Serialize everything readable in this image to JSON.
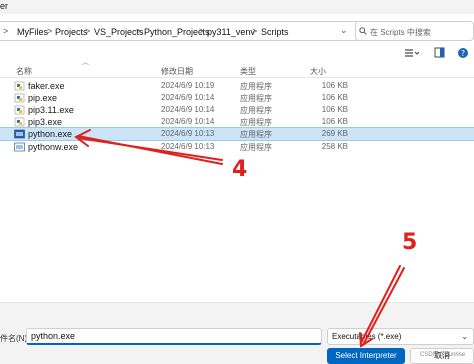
{
  "window": {
    "title_fragment": "er"
  },
  "address_bar": {
    "breadcrumbs": [
      "MyFiles",
      "Projects",
      "VS_Projects",
      "Python_Projects",
      "py311_venv",
      "Scripts"
    ],
    "separator": ">"
  },
  "search": {
    "placeholder": "在 Scripts 中搜索",
    "icon": "search-icon"
  },
  "toolbar": {
    "view_icon": "view-menu-icon",
    "preview_icon": "preview-pane-icon",
    "help_icon": "help-icon"
  },
  "columns": {
    "name": "名称",
    "date": "修改日期",
    "type": "类型",
    "size": "大小"
  },
  "files": [
    {
      "name": "faker.exe",
      "date": "2024/6/9 10:19",
      "type": "应用程序",
      "size": "106 KB",
      "icon": "python-exe-icon",
      "selected": false
    },
    {
      "name": "pip.exe",
      "date": "2024/6/9 10:14",
      "type": "应用程序",
      "size": "106 KB",
      "icon": "python-exe-icon",
      "selected": false
    },
    {
      "name": "pip3.11.exe",
      "date": "2024/6/9 10:14",
      "type": "应用程序",
      "size": "106 KB",
      "icon": "python-exe-icon",
      "selected": false
    },
    {
      "name": "pip3.exe",
      "date": "2024/6/9 10:14",
      "type": "应用程序",
      "size": "106 KB",
      "icon": "python-exe-icon",
      "selected": false
    },
    {
      "name": "python.exe",
      "date": "2024/6/9 10:13",
      "type": "应用程序",
      "size": "269 KB",
      "icon": "python-app-icon",
      "selected": true
    },
    {
      "name": "pythonw.exe",
      "date": "2024/6/9 10:13",
      "type": "应用程序",
      "size": "258 KB",
      "icon": "python-app-icon",
      "selected": false
    }
  ],
  "annotations": {
    "step4": "4",
    "step5": "5",
    "color": "#e0201c"
  },
  "footer": {
    "filename_label": "件名(N):",
    "filename_value": "python.exe",
    "filter_value": "Executables (*.exe)",
    "select_button": "Select Interpreter",
    "cancel_button": "取消",
    "watermark": "CSDN @Sunrise"
  },
  "colors": {
    "accent": "#0067c0",
    "selection": "#cce4f7",
    "annotation": "#e0201c"
  }
}
